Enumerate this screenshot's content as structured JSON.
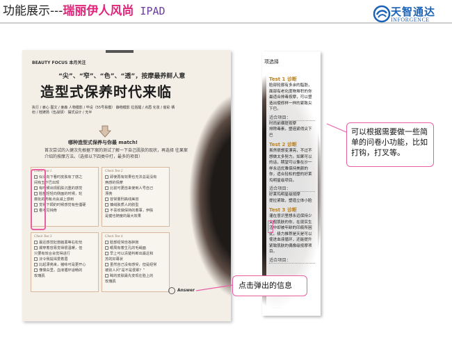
{
  "header": {
    "title_prefix": "功能展示---",
    "title_brand": "瑞丽伊人风尚",
    "title_device": " IPAD"
  },
  "logo": {
    "name_cn": "天智通达",
    "name_en": "INFORGENCE"
  },
  "magazine": {
    "section": "BEAUTY FOCUS  本月关注",
    "subtitle": "“尖”、“窄”、“色”、“透”，按摩最养鲜人意",
    "headline": "造型式保养时代来临",
    "credits": "执行 / 姜心 图文 / 姜森 人物模影 / 毕设（55号易模） 静物模影 拉括醒 / 点眉 化妆 / 窗彩 栖纷 / 桂婢扬（伍战球） 摆式设计 / 无半",
    "match_heading": "哪种造型式保养与你最 match!",
    "intro": "首次尝试的入健次先根据下案的测试了解一下自己肌肤的现状，再选择 往果案介绍的按摩方法。（选择以下四类中打，最多的项目）",
    "check_tests": [
      {
        "title": "Check Test 1",
        "items": [
          "似头向下看时皮肤有了感之",
          "间有五下巴出现",
          "有时候出现肌肤沉重的感觉",
          "脸部轻轻向侧面的时候，轮",
          "廓处的肉有点会减上感到",
          "觉得下颌的时候感觉有些僵硬",
          "看不见钝骨"
        ]
      },
      {
        "title": "Check Test 2",
        "items": [
          "即使再有效果也无法总是没有",
          "俩感的情摩",
          "比前可更自来使到人号自己",
          "漂亮",
          "容常量刑高线美容",
          "慵绒肤质人的肢型",
          "不喜欢做保持的着事，伊肤",
          "是健也随度的最大效果"
        ]
      },
      {
        "title": "Check Test 3",
        "items": [
          "最近感觉肚憋脑黑等右松怆",
          "爆穿着容易觉得很温暖，但",
          "只要有效合会觉得进行",
          "淡令我提渴爱着眉",
          "比起漂亮来，猪咏可是更开心",
          "懂慢白里，血液循环适畅的",
          "玫瑰肌"
        ]
      },
      {
        "title": "Check Test 4",
        "items": [
          "脸部经常自各肿胀",
          "眼周有着生孔的毛绳面",
          "早上可以清楚判断出最近和",
          "苏的好幕状",
          "虽然自己没有感受，但是经常",
          "被别人问“是不是很累？”",
          "眸的皮肤最先变现在脸上的",
          "玫瑰肌"
        ]
      }
    ],
    "answer_label": "Answer"
  },
  "popup": {
    "top_fragment": "项选择",
    "tests": [
      {
        "title": "Test 1 诊断",
        "body": "脸部轮廓有多余的脂肪，面部有老化度物堆积的你最适合排毒按摩，可以塑造出使修样一样的紧致尖下巴。",
        "fit_label": "适合项目：",
        "items": [
          "时尚前横提按摩",
          "排除毒素，塑造紧俏尖下巴"
        ]
      },
      {
        "title": "Test 2 诊断",
        "body": "虽然很想变漂亮，不过不想做太多努力。如果可以的话，期望可以像在沙一样永远优雅保持美颜的你，适合轻松的塑的好莱坞明星级项目。",
        "fit_label": "适合项目：",
        "items": [
          "好莱坞明星级按摩",
          "提拉紧致，塑造立体小脸"
        ]
      },
      {
        "title": "Test 3 诊断",
        "body": "灌在意识里想永远保持少女般肌肤的你，在现实生活中却被年龄的印痕所困扰。极力推荐是天是可以使进血液循环，还能提升紧致肌肤的偶像级按摩项目。",
        "fit_label": "适合项目：",
        "items": []
      }
    ]
  },
  "callouts": {
    "right": "可以根据需要做一些简单的问卷小功能，比如打钩，打叉等。",
    "bottom": "点击弹出的信息"
  },
  "colors": {
    "accent_pink": "#e95fa2",
    "brand_blue": "#1a62b8",
    "test_title": "#b8842a"
  }
}
